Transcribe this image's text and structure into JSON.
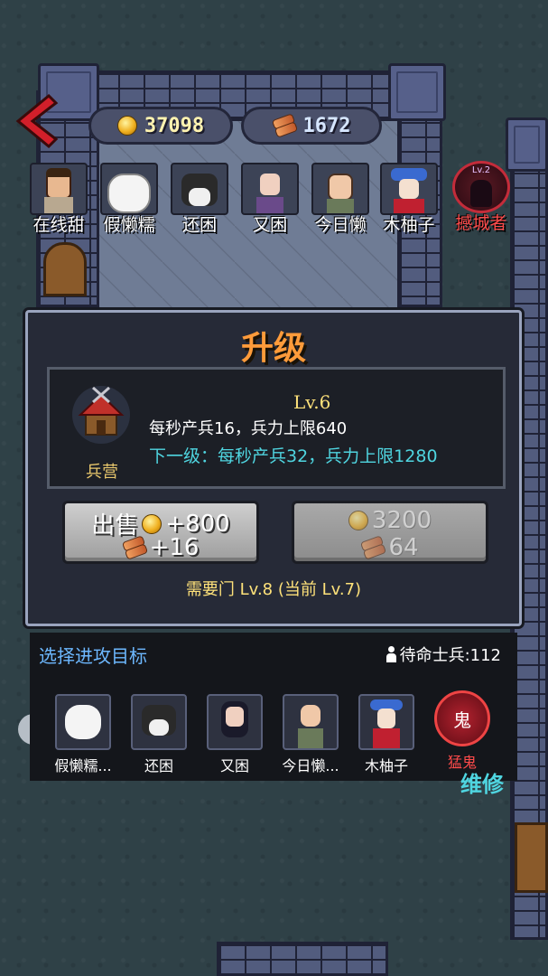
{
  "resources": {
    "gold": "37098",
    "wood": "1672"
  },
  "players": [
    {
      "name": "在线甜"
    },
    {
      "name": "假懒糯"
    },
    {
      "name": "还困"
    },
    {
      "name": "又困"
    },
    {
      "name": "今日懒"
    },
    {
      "name": "木柚子"
    },
    {
      "name": "撼城者",
      "level": "Lv.2"
    }
  ],
  "modal": {
    "title": "升级",
    "building_name": "兵营",
    "level": "Lv.6",
    "current": "每秒产兵16，兵力上限640",
    "next": "下一级：每秒产兵32，兵力上限1280",
    "sell_label": "出售",
    "sell_gold": "+800",
    "sell_wood": "+16",
    "upgrade_gold": "3200",
    "upgrade_wood": "64",
    "requirement": "需要门 Lv.8 (当前 Lv.7)"
  },
  "targets": {
    "title": "选择进攻目标",
    "soldiers": "待命士兵:112",
    "items": [
      {
        "name": "假懒糯..."
      },
      {
        "name": "还困"
      },
      {
        "name": "又困"
      },
      {
        "name": "今日懒..."
      },
      {
        "name": "木柚子"
      },
      {
        "name": "猛鬼",
        "badge": "鬼"
      }
    ]
  },
  "side_label": "维修",
  "colors": {
    "title_orange": "#ff9b3a",
    "next_cyan": "#4fd5e0",
    "enemy_red": "#ff4b4b",
    "target_blue": "#6db8ff"
  }
}
